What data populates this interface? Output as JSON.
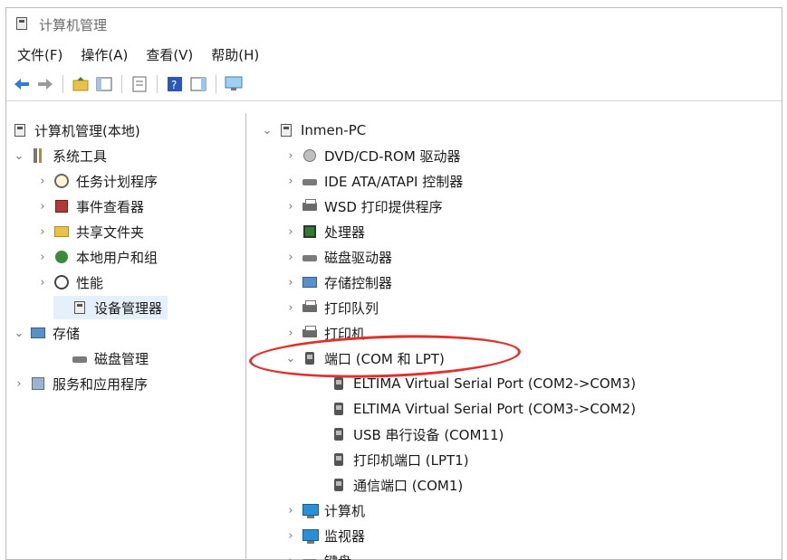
{
  "window": {
    "title": "计算机管理"
  },
  "menu": [
    "文件(F)",
    "操作(A)",
    "查看(V)",
    "帮助(H)"
  ],
  "toolbar": {
    "icons": [
      "back-arrow-icon",
      "forward-arrow-icon",
      "up-folder-icon",
      "console-tree-icon",
      "properties-icon",
      "help-icon",
      "action-pane-icon",
      "computer-monitor-icon"
    ]
  },
  "left_tree": {
    "root": "计算机管理(本地)",
    "items": [
      {
        "label": "系统工具",
        "level": 1,
        "expanded": true
      },
      {
        "label": "任务计划程序",
        "level": 2,
        "expanded": false
      },
      {
        "label": "事件查看器",
        "level": 2,
        "expanded": false
      },
      {
        "label": "共享文件夹",
        "level": 2,
        "expanded": false
      },
      {
        "label": "本地用户和组",
        "level": 2,
        "expanded": false
      },
      {
        "label": "性能",
        "level": 2,
        "expanded": false
      },
      {
        "label": "设备管理器",
        "level": 2,
        "selected": true
      },
      {
        "label": "存储",
        "level": 1,
        "expanded": true
      },
      {
        "label": "磁盘管理",
        "level": 2
      },
      {
        "label": "服务和应用程序",
        "level": 1,
        "expanded": false
      }
    ]
  },
  "device_tree": {
    "root": "Inmen-PC",
    "items": [
      {
        "label": "DVD/CD-ROM 驱动器"
      },
      {
        "label": "IDE ATA/ATAPI 控制器"
      },
      {
        "label": "WSD 打印提供程序"
      },
      {
        "label": "处理器"
      },
      {
        "label": "磁盘驱动器"
      },
      {
        "label": "存储控制器"
      },
      {
        "label": "打印队列"
      },
      {
        "label": "打印机"
      },
      {
        "label": "端口 (COM 和 LPT)",
        "expanded": true
      },
      {
        "label": "ELTIMA Virtual Serial Port (COM2->COM3)",
        "child": true
      },
      {
        "label": "ELTIMA Virtual Serial Port (COM3->COM2)",
        "child": true
      },
      {
        "label": "USB 串行设备 (COM11)",
        "child": true
      },
      {
        "label": "打印机端口 (LPT1)",
        "child": true
      },
      {
        "label": "通信端口 (COM1)",
        "child": true
      },
      {
        "label": "计算机"
      },
      {
        "label": "监视器"
      },
      {
        "label": "键盘"
      }
    ]
  },
  "colors": {
    "annotation": "#e0312c",
    "selection": "#e5f0fb"
  }
}
